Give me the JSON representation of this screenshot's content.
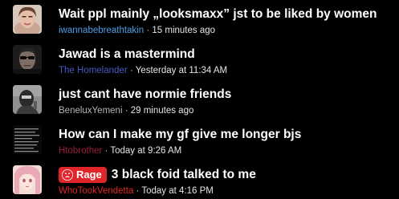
{
  "threads": [
    {
      "title": "Wait ppl mainly „looksmaxx” jst to be liked by women",
      "username": "iwannabebreathtakin",
      "user_color": "#4d9fe6",
      "separator": "·",
      "time": "15 minutes ago",
      "avatar": "portrait-photo"
    },
    {
      "title": "Jawad is a mastermind",
      "username": "The Homelander",
      "user_color": "#4758c4",
      "separator": "·",
      "time": "Yesterday at 11:34 AM",
      "avatar": "dark-sunglasses-photo"
    },
    {
      "title": "just cant have normie friends",
      "username": "BeneluxYemeni",
      "user_color": "#b5b5b5",
      "separator": "·",
      "time": "29 minutes ago",
      "avatar": "masked-figure-photo"
    },
    {
      "title": "How can I make my gf give me longer bjs",
      "username": "Htobrother",
      "user_color": "#9b1f3c",
      "separator": "·",
      "time": "Today at 9:26 AM",
      "avatar": "text-image"
    },
    {
      "title": "3 black foid talked to me",
      "username": "WhoTookVendetta",
      "user_color": "#e02626",
      "separator": "·",
      "time": "Today at 4:16 PM",
      "avatar": "anime-girl-image",
      "badge": {
        "label": "Rage",
        "color": "#e0262b",
        "icon": "angry-face-icon"
      }
    }
  ]
}
